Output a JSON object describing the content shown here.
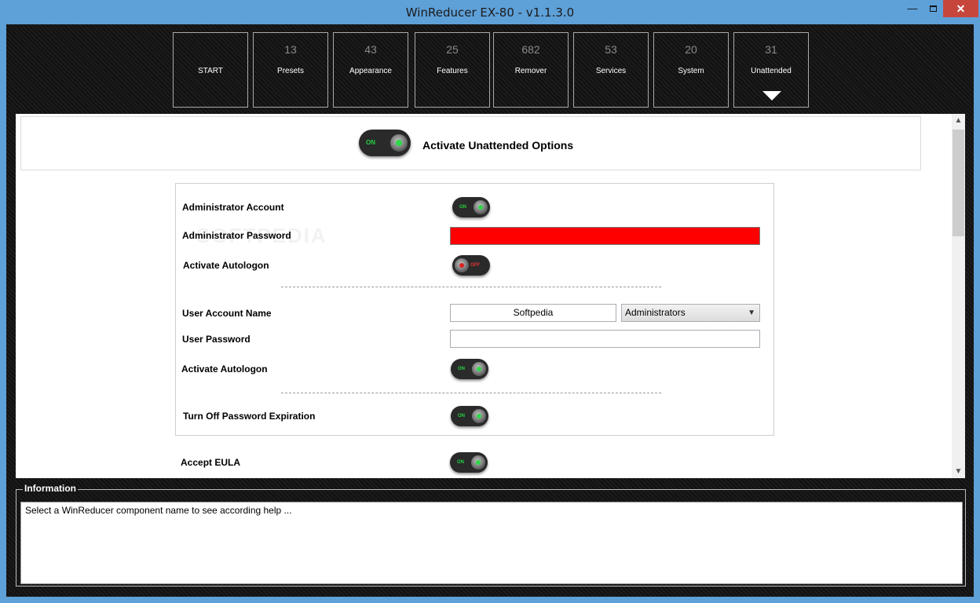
{
  "window": {
    "title": "WinReducer EX-80 - v1.1.3.0",
    "minimize_label": "—",
    "close_label": "✕"
  },
  "tiles": [
    {
      "count": "",
      "label": "START"
    },
    {
      "count": "13",
      "label": "Presets"
    },
    {
      "count": "43",
      "label": "Appearance"
    },
    {
      "count": "25",
      "label": "Features"
    },
    {
      "count": "682",
      "label": "Remover"
    },
    {
      "count": "53",
      "label": "Services"
    },
    {
      "count": "20",
      "label": "System"
    },
    {
      "count": "31",
      "label": "Unattended",
      "selected": true
    }
  ],
  "main": {
    "header_title": "Activate Unattended Options",
    "header_toggle": "ON",
    "watermark": "SOFTPEDIA",
    "rows": {
      "admin_account": {
        "label": "Administrator Account",
        "toggle": "ON"
      },
      "admin_password": {
        "label": "Administrator Password",
        "value": ""
      },
      "admin_autologon": {
        "label": "Activate Autologon",
        "toggle": "OFF"
      },
      "user_account_name": {
        "label": "User Account Name",
        "value": "Softpedia",
        "group": "Administrators"
      },
      "user_password": {
        "label": "User Password",
        "value": ""
      },
      "user_autologon": {
        "label": "Activate Autologon",
        "toggle": "ON"
      },
      "password_expiration": {
        "label": "Turn Off Password Expiration",
        "toggle": "ON"
      },
      "accept_eula": {
        "label": "Accept EULA",
        "toggle": "ON"
      }
    }
  },
  "information": {
    "title": "Information",
    "text": "Select a WinReducer component name to see according help ..."
  },
  "colors": {
    "accent_on": "#25d140",
    "accent_off": "#e33333",
    "password_error": "#ff0000",
    "titlebar": "#5ea0d8"
  }
}
